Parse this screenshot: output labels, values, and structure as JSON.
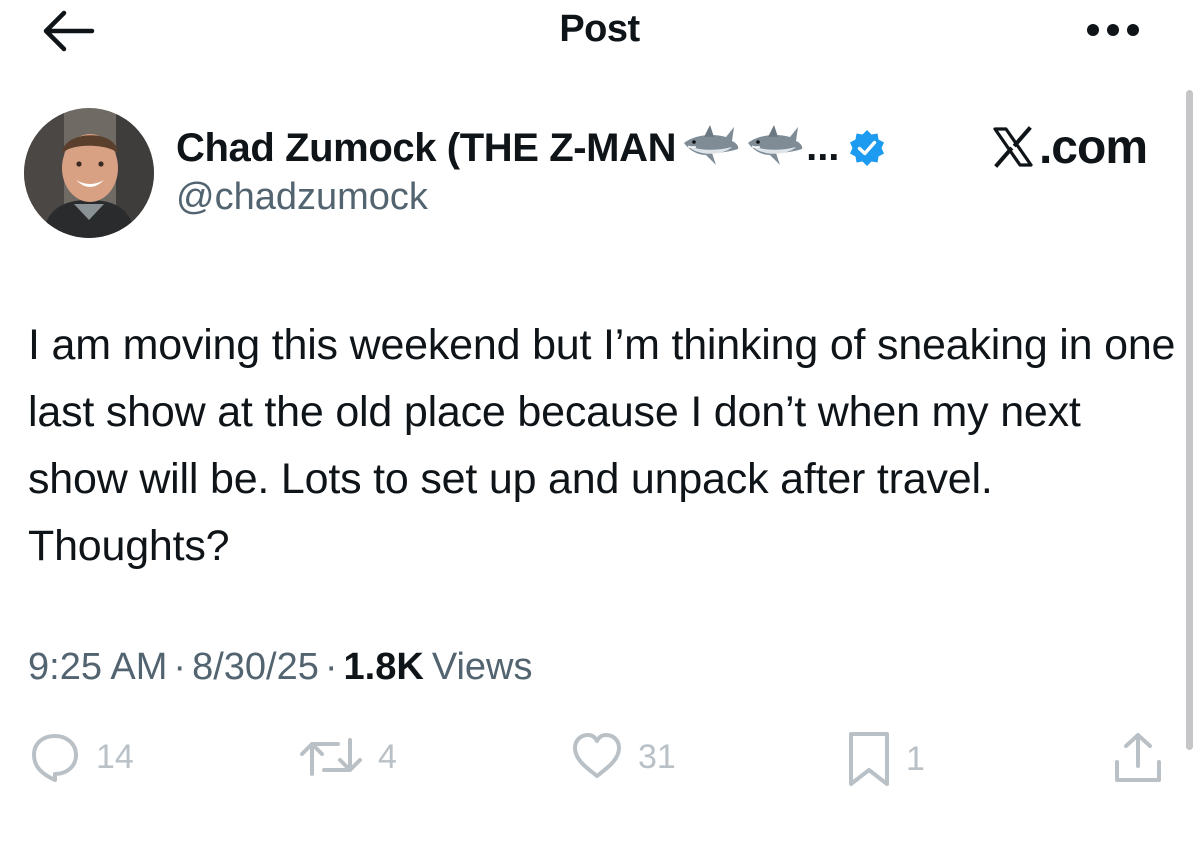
{
  "header": {
    "title": "Post",
    "back_icon": "arrow-left-icon",
    "more_icon": "more-horizontal-icon"
  },
  "author": {
    "display_name": "Chad Zumock (THE Z-MAN",
    "name_emoji": "shark-emoji",
    "name_overflow": "...",
    "verified_icon": "verified-badge-icon",
    "verified_color": "#1d9bf0",
    "handle": "@chadzumock"
  },
  "watermark": {
    "logo_letter": "X",
    "text": ".com"
  },
  "tweet": {
    "text": "I am moving this weekend but I’m thinking of sneaking in one last show at the old place because I don’t when my next show will be. Lots to set up and unpack after travel. Thoughts?"
  },
  "meta": {
    "time": "9:25 AM",
    "separator": "·",
    "date": "8/30/25",
    "views_count": "1.8K",
    "views_label": "Views"
  },
  "actions": {
    "replies": {
      "icon": "reply-icon",
      "count": "14"
    },
    "reposts": {
      "icon": "repost-icon",
      "count": "4"
    },
    "likes": {
      "icon": "heart-icon",
      "count": "31"
    },
    "bookmarks": {
      "icon": "bookmark-icon",
      "count": "1"
    },
    "share": {
      "icon": "share-icon"
    }
  },
  "colors": {
    "text": "#0f1419",
    "secondary": "#536471",
    "action_gray": "#b9c1c7"
  }
}
